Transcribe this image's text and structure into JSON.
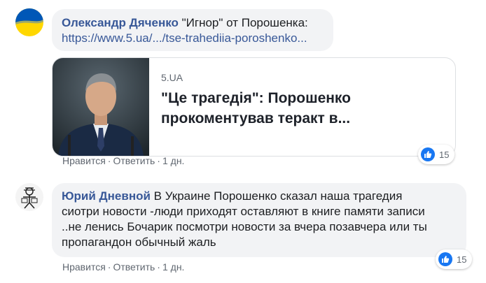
{
  "comments": [
    {
      "author": "Олександр Дяченко",
      "text": "\"Игнор\" от Порошенка:",
      "link": "https://www.5.ua/.../tse-trahediia-poroshenko...",
      "preview": {
        "domain": "5.UA",
        "title": "\"Це трагедія\": Порошенко прокоментував теракт в..."
      },
      "actions": {
        "like": "Нравится",
        "reply": "Ответить",
        "time": "1 дн."
      },
      "reactions": {
        "icon": "like-icon",
        "count": "15"
      }
    },
    {
      "author": "Юрий Дневной",
      "text_lines": [
        "В Украине Порошенко сказал наша трагедия",
        "сиотри новости -люди приходят оставляют в книге памяти записи",
        "..не ленись Бочарик посмотри новости за вчера позавчера или ты",
        "пропагандон обычный жаль"
      ],
      "actions": {
        "like": "Нравится",
        "reply": "Ответить",
        "time": "1 дн."
      },
      "reactions": {
        "icon": "like-icon",
        "count": "15"
      }
    }
  ],
  "colors": {
    "author": "#385898",
    "bubble": "#f2f3f5",
    "like": "#1877f2",
    "flag_blue": "#0057b7",
    "flag_yellow": "#ffd700"
  }
}
